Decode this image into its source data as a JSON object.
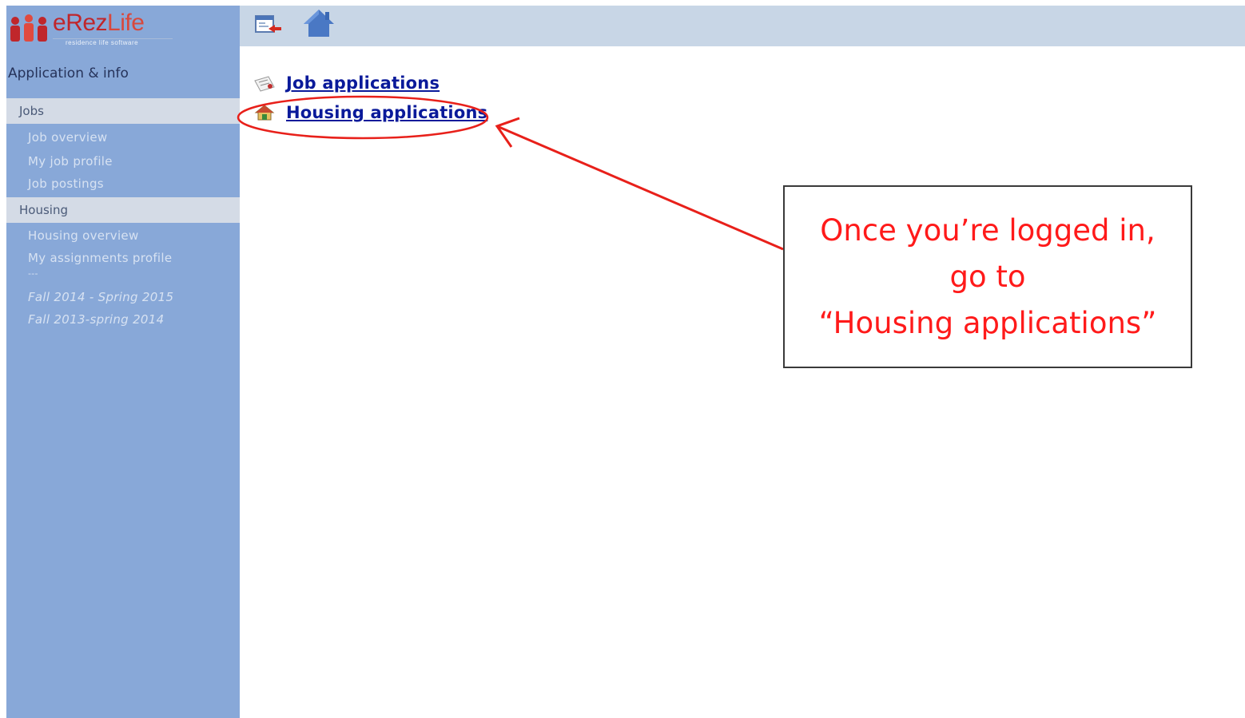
{
  "logo": {
    "name_e": "e",
    "name_rez": "Rez",
    "name_life": "Life",
    "tagline": "residence life software"
  },
  "sidebar": {
    "heading": "Application & info",
    "jobs_section": "Jobs",
    "jobs_items": [
      "Job overview",
      "My job profile",
      "Job postings"
    ],
    "housing_section": "Housing",
    "housing_items": [
      "Housing overview",
      "My assignments profile",
      "---"
    ],
    "term_items": [
      "Fall 2014 - Spring 2015",
      "Fall 2013-spring 2014"
    ]
  },
  "toolbar": {
    "back_icon": "logout-icon",
    "home_icon": "home-icon"
  },
  "main": {
    "links": [
      {
        "label": "Job applications",
        "icon": "document-icon"
      },
      {
        "label": "Housing applications",
        "icon": "house-icon"
      }
    ]
  },
  "annotation": {
    "line1": "Once you’re logged in,",
    "line2": "go to",
    "line3": "“Housing applications”",
    "color": "#ff1a1a"
  },
  "colors": {
    "sidebar": "#88a8d8",
    "topbar": "#c8d6e6",
    "link": "#0a1a9a",
    "section": "#d4dbe6"
  }
}
